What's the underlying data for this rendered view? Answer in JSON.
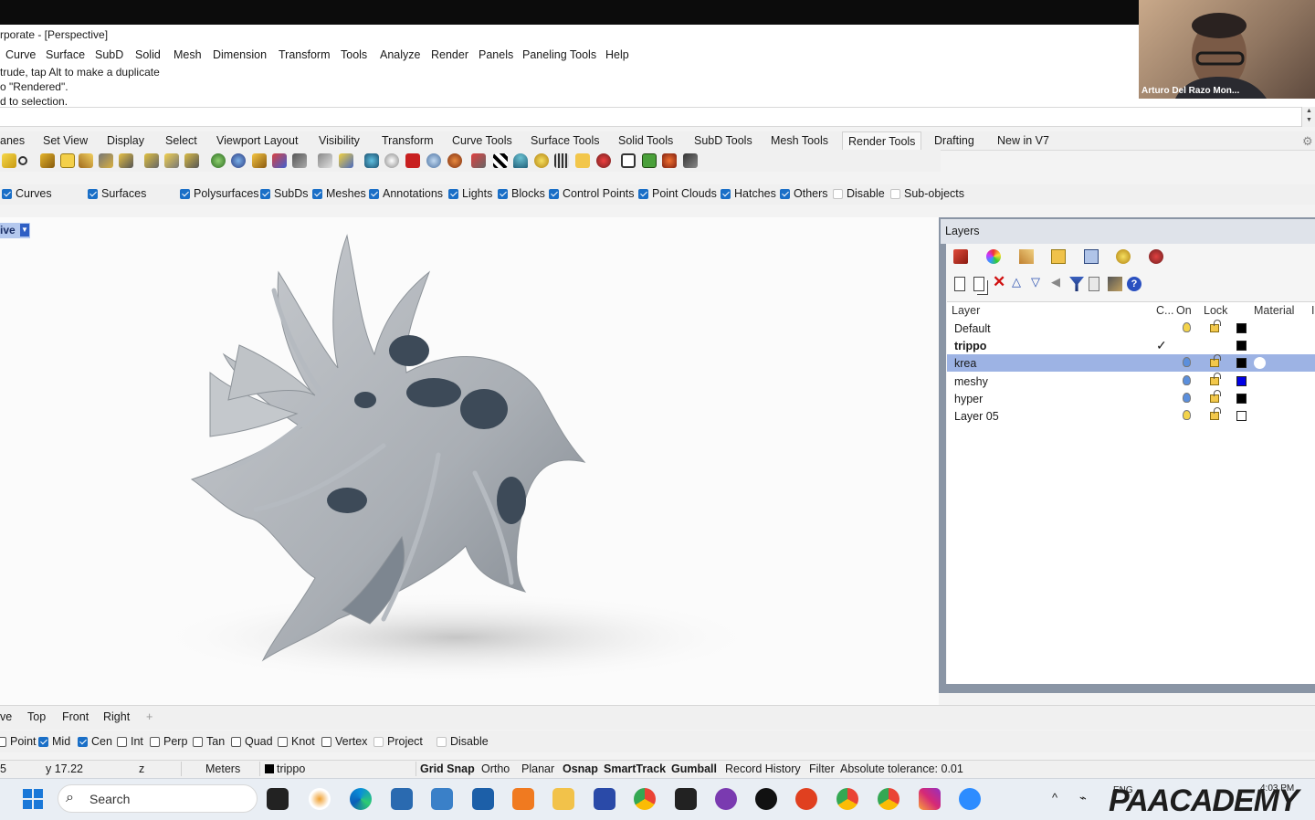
{
  "window": {
    "title": "rporate - [Perspective]"
  },
  "menu": [
    "Curve",
    "Surface",
    "SubD",
    "Solid",
    "Mesh",
    "Dimension",
    "Transform",
    "Tools",
    "Analyze",
    "Render",
    "Panels",
    "Paneling Tools",
    "Help"
  ],
  "command_history": [
    "trude, tap Alt to make a duplicate",
    "o \"Rendered\".",
    "d to selection."
  ],
  "toolbar_tabs": [
    "anes",
    "Set View",
    "Display",
    "Select",
    "Viewport Layout",
    "Visibility",
    "Transform",
    "Curve Tools",
    "Surface Tools",
    "Solid Tools",
    "SubD Tools",
    "Mesh Tools",
    "Render Tools",
    "Drafting",
    "New in V7"
  ],
  "active_tab": "Render Tools",
  "selection_filters": [
    {
      "label": "Curves",
      "checked": true
    },
    {
      "label": "Surfaces",
      "checked": true
    },
    {
      "label": "Polysurfaces",
      "checked": true
    },
    {
      "label": "SubDs",
      "checked": true
    },
    {
      "label": "Meshes",
      "checked": true
    },
    {
      "label": "Annotations",
      "checked": true
    },
    {
      "label": "Lights",
      "checked": true
    },
    {
      "label": "Blocks",
      "checked": true
    },
    {
      "label": "Control Points",
      "checked": true
    },
    {
      "label": "Point Clouds",
      "checked": true
    },
    {
      "label": "Hatches",
      "checked": true
    },
    {
      "label": "Others",
      "checked": true
    },
    {
      "label": "Disable",
      "checked": false
    },
    {
      "label": "Sub-objects",
      "checked": false
    }
  ],
  "viewport": {
    "label": "ive"
  },
  "layers_panel": {
    "title": "Layers",
    "columns": [
      "Layer",
      "C...",
      "On",
      "Lock",
      "Material",
      "I"
    ],
    "layers": [
      {
        "name": "Default",
        "current": false,
        "bold": false,
        "selected": false,
        "bulb": "#f3d34a",
        "swatch": "#000000"
      },
      {
        "name": "trippo",
        "current": true,
        "bold": true,
        "selected": false,
        "bulb": "none",
        "swatch": "#000000"
      },
      {
        "name": "krea",
        "current": false,
        "bold": false,
        "selected": true,
        "bulb": "#5b8fdd",
        "swatch": "#000000"
      },
      {
        "name": "meshy",
        "current": false,
        "bold": false,
        "selected": false,
        "bulb": "#5b8fdd",
        "swatch": "#0000e6"
      },
      {
        "name": "hyper",
        "current": false,
        "bold": false,
        "selected": false,
        "bulb": "#5b8fdd",
        "swatch": "#000000"
      },
      {
        "name": "Layer 05",
        "current": false,
        "bold": false,
        "selected": false,
        "bulb": "#f3d34a",
        "swatch": "#ffffff"
      }
    ],
    "check_glyph": "✓"
  },
  "viewport_tabs": [
    "ve",
    "Top",
    "Front",
    "Right",
    "+"
  ],
  "osnaps": [
    {
      "label": "Point",
      "checked": false
    },
    {
      "label": "Mid",
      "checked": true
    },
    {
      "label": "Cen",
      "checked": true
    },
    {
      "label": "Int",
      "checked": false
    },
    {
      "label": "Perp",
      "checked": false
    },
    {
      "label": "Tan",
      "checked": false
    },
    {
      "label": "Quad",
      "checked": false
    },
    {
      "label": "Knot",
      "checked": false
    },
    {
      "label": "Vertex",
      "checked": false
    },
    {
      "label": "Project",
      "checked": false
    },
    {
      "label": "Disable",
      "checked": false
    }
  ],
  "status": {
    "x": "5",
    "y": "y 17.22",
    "z": "z",
    "units": "Meters",
    "layer": "trippo",
    "grid_snap": "Grid Snap",
    "ortho": "Ortho",
    "planar": "Planar",
    "osnap": "Osnap",
    "smarttrack": "SmartTrack",
    "gumball": "Gumball",
    "record_history": "Record History",
    "filter": "Filter",
    "tolerance": "Absolute tolerance: 0.01"
  },
  "taskbar": {
    "search_label": "Search",
    "tray_lang": "ENG",
    "clock": "4:03 PM"
  },
  "webcam": {
    "name": "Arturo Del Razo Mon..."
  },
  "watermark": {
    "brand": "PAACADEMY"
  },
  "colors": {
    "accent": "#1a6fc7",
    "selected_row": "#9db3e4",
    "viewport_bg": "#fbfbfb"
  }
}
